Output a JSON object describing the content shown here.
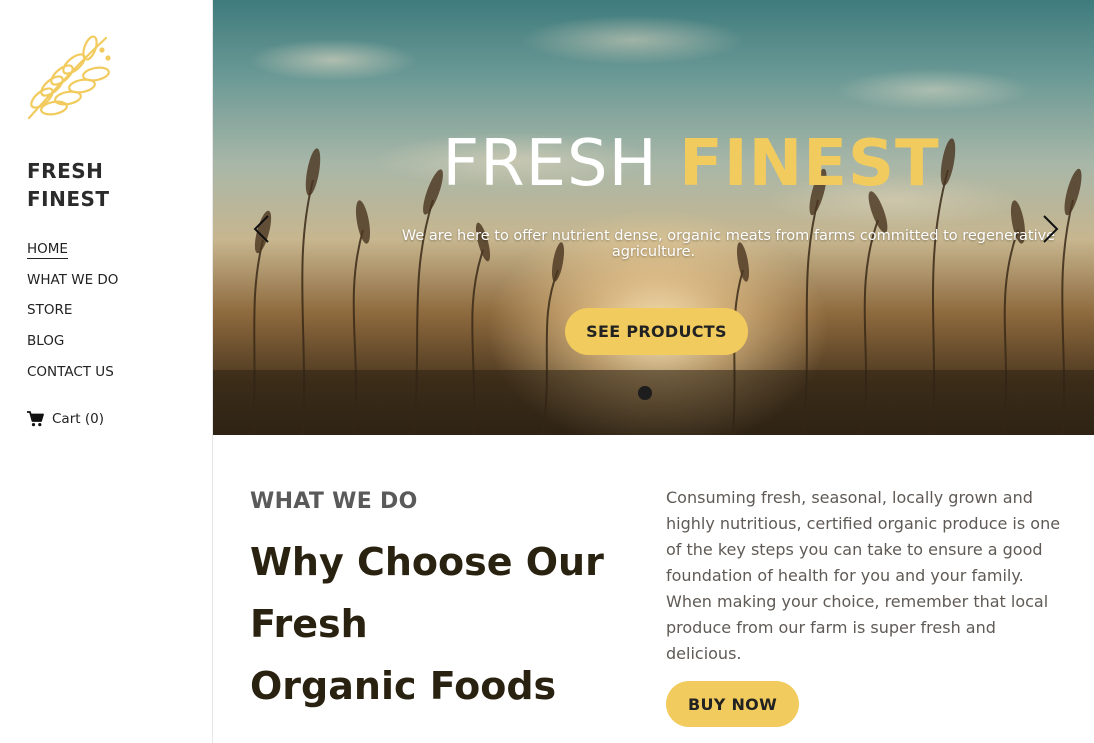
{
  "brand": {
    "line1": "FRESH",
    "line2": "FINEST"
  },
  "nav": {
    "items": [
      {
        "label": "HOME",
        "active": true
      },
      {
        "label": "WHAT WE DO"
      },
      {
        "label": "STORE"
      },
      {
        "label": "BLOG"
      },
      {
        "label": "CONTACT US"
      }
    ]
  },
  "cart": {
    "label": "Cart (0)",
    "icon": "shopping-cart-icon"
  },
  "hero": {
    "title_part1": "FRESH",
    "title_part2": "FINEST",
    "subtitle": "We are here to offer nutrient dense, organic meats from farms committed to regenerative agriculture.",
    "button": "SEE PRODUCTS",
    "prev_icon": "chevron-left-icon",
    "next_icon": "chevron-right-icon"
  },
  "section": {
    "eyebrow": "WHAT WE DO",
    "headline_lines": [
      "Why Choose Our",
      "Fresh",
      "Organic Foods"
    ],
    "body": "Consuming fresh, seasonal, locally grown and highly nutritious, certified organic produce is one of the key steps you can take to ensure a good foundation of health for you and your family. When making your choice, remember that local produce from our farm is super fresh and delicious.",
    "button": "BUY NOW"
  },
  "colors": {
    "accent": "#f2cb5e",
    "headline": "#2a2210",
    "body": "#5f5a55"
  }
}
